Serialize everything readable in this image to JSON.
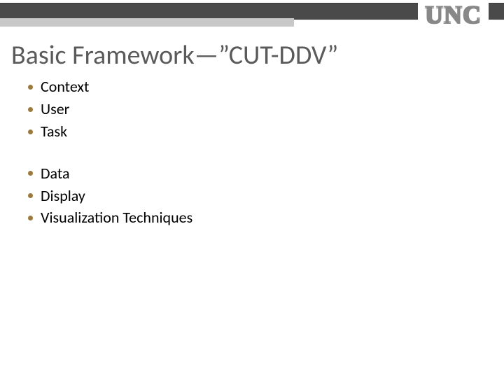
{
  "header": {
    "logo": "UNC"
  },
  "title": "Basic Framework—”CUT-DDV”",
  "group1": {
    "items": [
      "Context",
      "User",
      "Task"
    ]
  },
  "group2": {
    "items": [
      "Data",
      "Display",
      "Visualization Techniques"
    ]
  }
}
